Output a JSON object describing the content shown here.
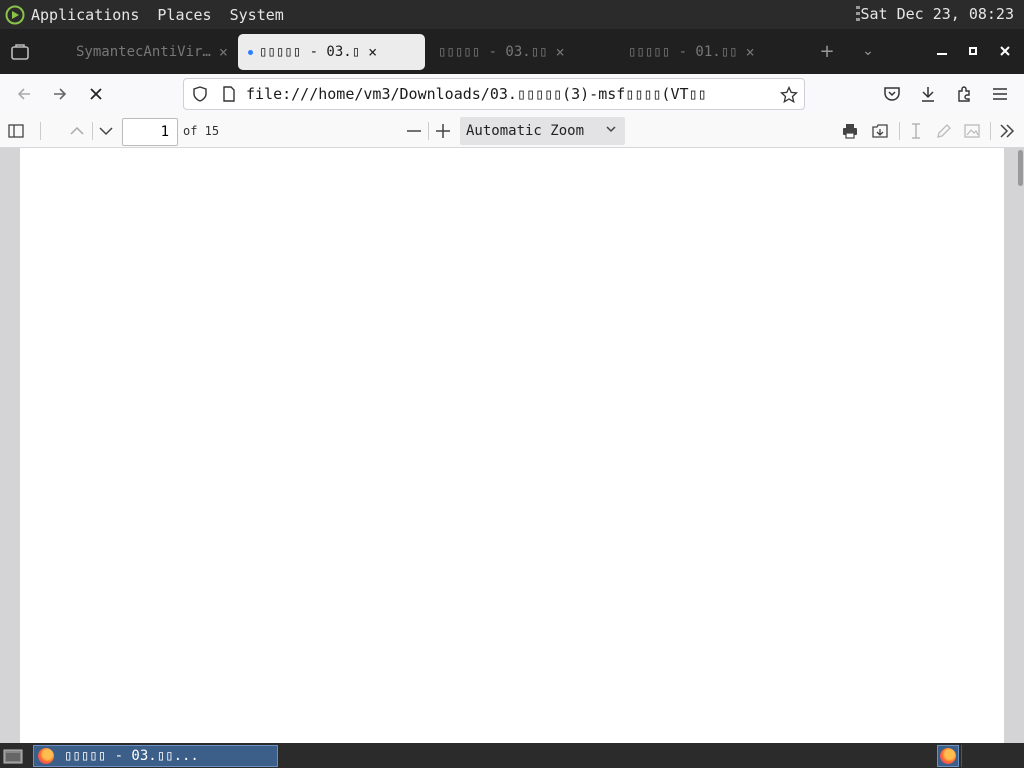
{
  "top_panel": {
    "menus": [
      "Applications",
      "Places",
      "System"
    ],
    "clock": "Sat Dec 23, 08:23"
  },
  "tabs": [
    {
      "label": "SymantecAntiVir…",
      "active": false
    },
    {
      "label": "▯▯▯▯▯ - 03.▯",
      "active": true
    },
    {
      "label": "▯▯▯▯▯ - 03.▯▯",
      "active": false
    },
    {
      "label": "▯▯▯▯▯ - 01.▯▯",
      "active": false
    }
  ],
  "new_tab_label": "+",
  "url": "file:///home/vm3/Downloads/03.▯▯▯▯▯(3)-msf▯▯▯▯(VT▯▯",
  "pdf_toolbar": {
    "page_number": "1",
    "page_count": "of 15",
    "zoom": "Automatic Zoom"
  },
  "taskbar": {
    "window_title": "▯▯▯▯▯ - 03.▯▯..."
  },
  "colors": {
    "panel_bg": "#2b2b2b",
    "tabstrip_bg": "#202020",
    "active_tab_bg": "#ececec",
    "viewer_bg": "#d4d4d7",
    "task_item_bg": "#3c5f8a"
  }
}
